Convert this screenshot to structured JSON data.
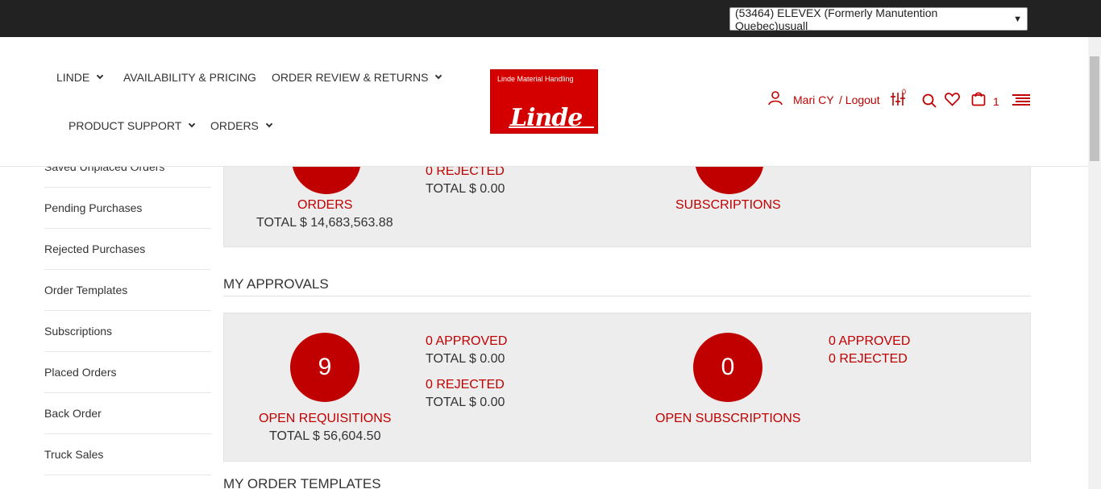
{
  "account_select": {
    "value": "(53464) ELEVEX (Formerly Manutention Quebec)usuall"
  },
  "nav": {
    "linde": "LINDE",
    "availability": "AVAILABILITY & PRICING",
    "order_review": "ORDER REVIEW & RETURNS",
    "product_support": "PRODUCT SUPPORT",
    "orders": "ORDERS"
  },
  "logo": {
    "tagline": "Linde Material Handling",
    "wordmark": "Linde"
  },
  "user": {
    "name": "Mari CY",
    "logout": "/ Logout",
    "compare_count": "0",
    "cart_count": "1"
  },
  "sidebar": {
    "items": [
      {
        "label": "Saved Unplaced Orders"
      },
      {
        "label": "Pending Purchases"
      },
      {
        "label": "Rejected Purchases"
      },
      {
        "label": "Order Templates"
      },
      {
        "label": "Subscriptions"
      },
      {
        "label": "Placed Orders"
      },
      {
        "label": "Back Order"
      },
      {
        "label": "Truck Sales"
      }
    ]
  },
  "summary": {
    "orders_label": "ORDERS",
    "orders_total": "TOTAL $ 14,683,563.88",
    "rejected": "0 REJECTED",
    "rejected_total": "TOTAL $ 0.00",
    "subscriptions_label": "SUBSCRIPTIONS"
  },
  "approvals": {
    "title": "MY APPROVALS",
    "requisitions_count": "9",
    "requisitions_label": "OPEN REQUISITIONS",
    "requisitions_total": "TOTAL $ 56,604.50",
    "approved": "0 APPROVED",
    "approved_total": "TOTAL $ 0.00",
    "rejected": "0 REJECTED",
    "rejected_total": "TOTAL $ 0.00",
    "subscriptions_count": "0",
    "subscriptions_label": "OPEN SUBSCRIPTIONS",
    "sub_approved": "0 APPROVED",
    "sub_rejected": "0 REJECTED"
  },
  "templates": {
    "title": "MY ORDER TEMPLATES"
  },
  "colors": {
    "accent": "#c00000",
    "topbar": "#222222",
    "panel": "#ededed"
  }
}
